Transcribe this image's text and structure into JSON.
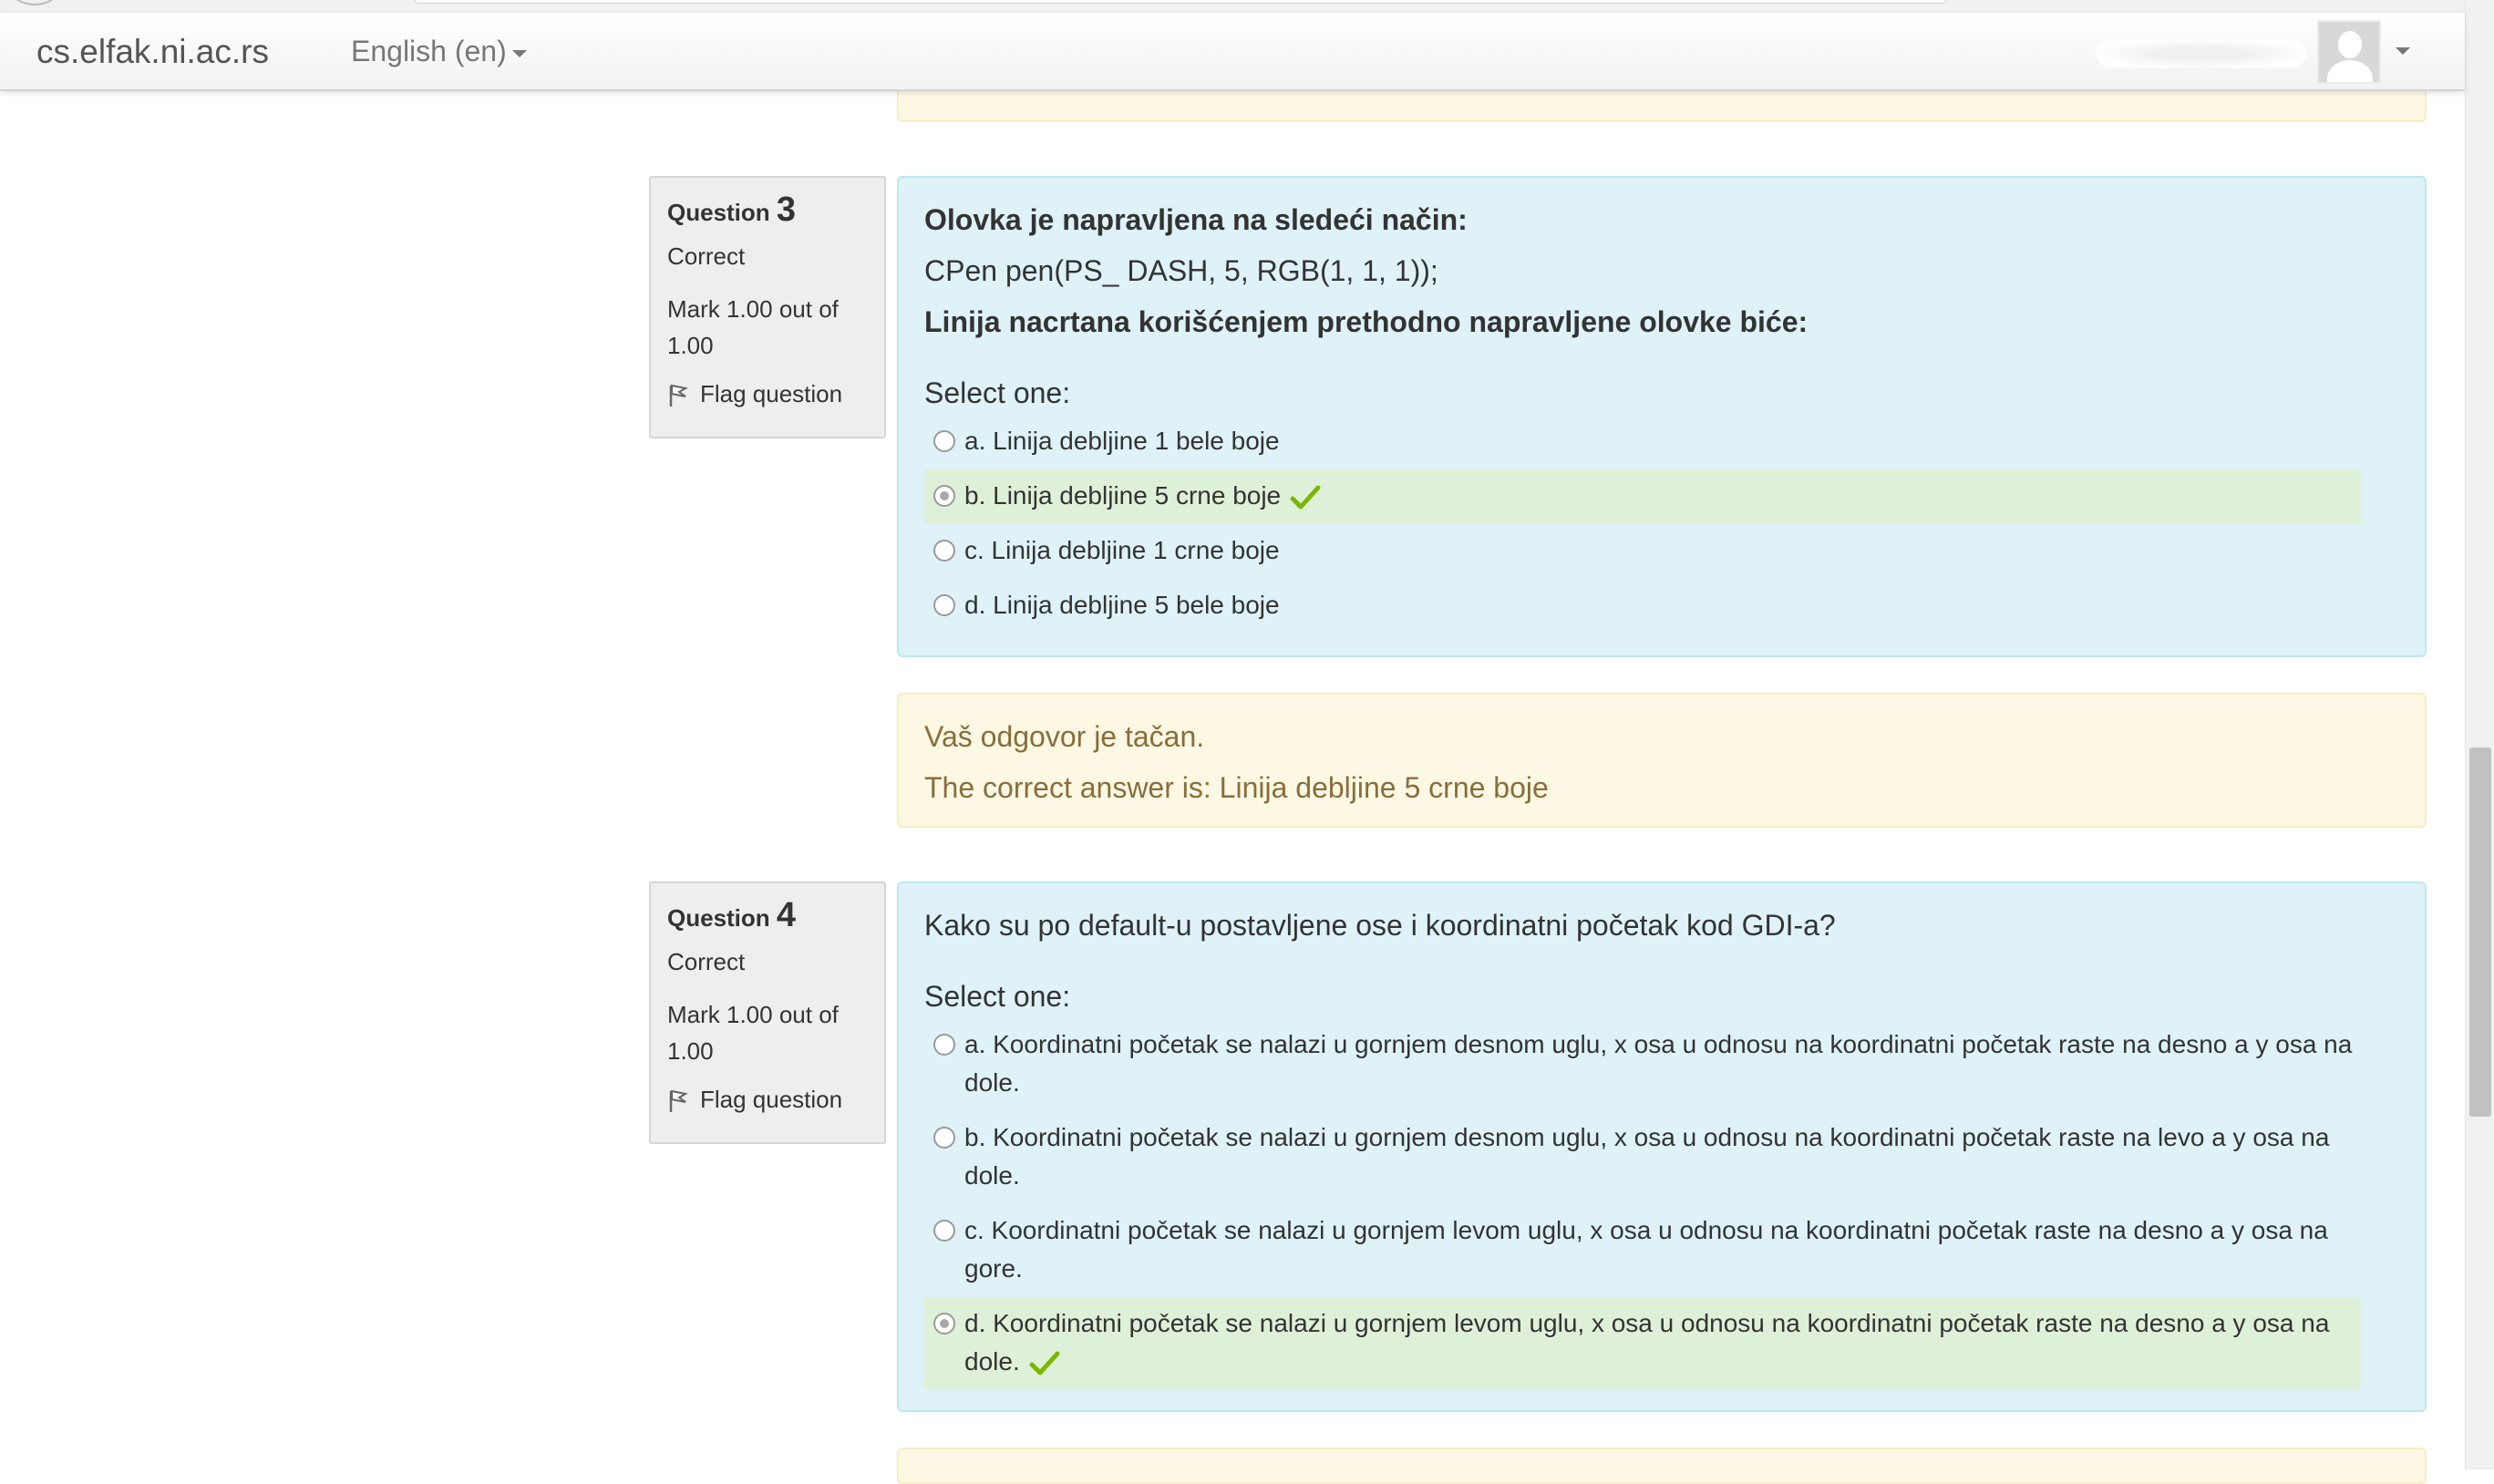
{
  "navbar": {
    "brand": "cs.elfak.ni.ac.rs",
    "language": "English (en)"
  },
  "questions": [
    {
      "label": "Question",
      "number": "3",
      "state": "Correct",
      "grade": "Mark 1.00 out of 1.00",
      "flag": "Flag question",
      "text_bold_1": "Olovka je napravljena na sledeći način:",
      "text_code": "CPen pen(PS_ DASH, 5, RGB(1, 1, 1));",
      "text_bold_2": "Linija nacrtana korišćenjem prethodno napravljene olovke biće:",
      "prompt": "Select one:",
      "answers": [
        {
          "text": "a. Linija debljine 1 bele boje",
          "selected": false,
          "correct": false
        },
        {
          "text": "b. Linija debljine 5 crne boje",
          "selected": true,
          "correct": true
        },
        {
          "text": "c. Linija debljine 1 crne boje",
          "selected": false,
          "correct": false
        },
        {
          "text": "d. Linija debljine 5 bele boje",
          "selected": false,
          "correct": false
        }
      ],
      "feedback": "Vaš odgovor je tačan.",
      "right_answer": "The correct answer is: Linija debljine 5 crne boje"
    },
    {
      "label": "Question",
      "number": "4",
      "state": "Correct",
      "grade": "Mark 1.00 out of 1.00",
      "flag": "Flag question",
      "text": "Kako su po default-u postavljene ose i koordinatni početak kod GDI-a?",
      "prompt": "Select one:",
      "answers": [
        {
          "text": "a. Koordinatni početak se nalazi u gornjem desnom uglu, x osa u odnosu na koordinatni početak raste na desno a y osa na dole.",
          "selected": false,
          "correct": false
        },
        {
          "text": "b. Koordinatni početak se nalazi u gornjem desnom uglu, x osa u odnosu na koordinatni početak raste na levo a y osa na dole.",
          "selected": false,
          "correct": false
        },
        {
          "text": "c. Koordinatni početak se nalazi u gornjem levom uglu, x osa u odnosu na koordinatni početak raste na desno a y osa na gore.",
          "selected": false,
          "correct": false
        },
        {
          "text": "d. Koordinatni početak se nalazi u gornjem levom uglu, x osa u odnosu na koordinatni početak raste na desno a y osa na dole.",
          "selected": true,
          "correct": true
        }
      ]
    }
  ],
  "colors": {
    "content_bg": "#def2f8",
    "feedback_bg": "#fcf8e3",
    "correct_bg": "#dff0d8",
    "check_green": "#7ab800"
  },
  "icons": [
    "flag-icon",
    "check-icon",
    "avatar-icon",
    "chevron-down-icon"
  ]
}
